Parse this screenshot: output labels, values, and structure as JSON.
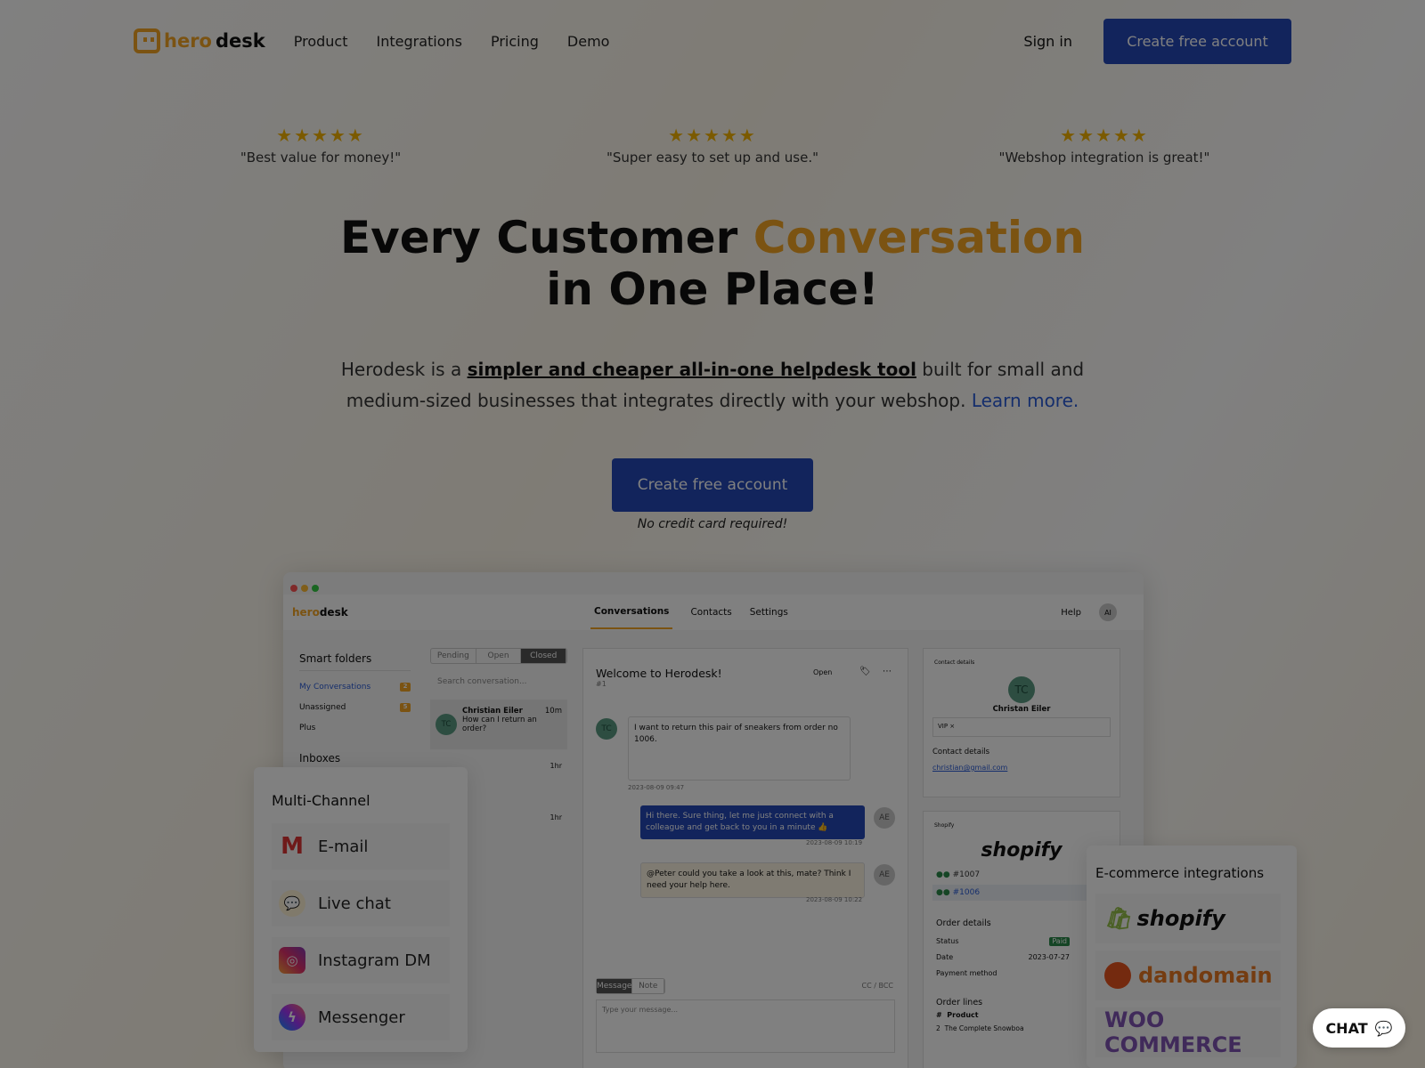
{
  "nav": {
    "logo_a": "hero",
    "logo_b": "desk",
    "links": [
      "Product",
      "Integrations",
      "Pricing",
      "Demo"
    ],
    "sign_in": "Sign in",
    "cta": "Create free account"
  },
  "reviews": [
    {
      "stars": "★★★★★",
      "text": "\"Best value for money!\""
    },
    {
      "stars": "★★★★★",
      "text": "\"Super easy to set up and use.\""
    },
    {
      "stars": "★★★★★",
      "text": "\"Webshop integration is great!\""
    }
  ],
  "hero": {
    "title_a": "Every Customer ",
    "title_accent": "Conversation",
    "title_b": " in One Place!",
    "sub_a": "Herodesk is a ",
    "sub_link": "simpler and cheaper all-in-one helpdesk tool",
    "sub_b": " built for small and medium-sized businesses that integrates directly with your webshop. ",
    "learn_more": "Learn more.",
    "cta": "Create free account",
    "note": "No credit card required!"
  },
  "app": {
    "logo_a": "hero",
    "logo_b": "desk",
    "tabs": [
      "Conversations",
      "Contacts",
      "Settings"
    ],
    "help": "Help",
    "avatar": "AI",
    "smart_folders": "Smart folders",
    "folders": [
      {
        "label": "My Conversations",
        "count": "2"
      },
      {
        "label": "Unassigned",
        "count": "5"
      },
      {
        "label": "Plus",
        "count": ""
      }
    ],
    "inboxes": "Inboxes",
    "filters": [
      "Pending",
      "Open",
      "Closed"
    ],
    "search_placeholder": "Search conversation...",
    "conv": {
      "initials": "TC",
      "name": "Christian Eiler",
      "time": "10m",
      "preview": "How can I return an order?"
    },
    "other_times": [
      "1hr",
      "1hr"
    ],
    "chat": {
      "title": "Welcome to Herodesk!",
      "id": "#1",
      "status": "Open",
      "m1": "I want to return this pair of sneakers from order no 1006.",
      "t1": "2023-08-09 09:47",
      "m2": "Hi there. Sure thing, let me just connect with a colleague and get back to you in a minute 👍",
      "t2": "2023-08-09 10:19",
      "m3": "@Peter could you take a look at this, mate? Think I need your help here.",
      "t3": "2023-08-09 10:22",
      "agent": "AE",
      "cust": "TC",
      "compose_tabs": [
        "Message",
        "Note"
      ],
      "ccbcc": "CC / BCC",
      "placeholder": "Type your message..."
    },
    "contact": {
      "header": "Contact details",
      "initials": "TC",
      "name": "Christan Eiler",
      "tag": "VIP",
      "section": "Contact details",
      "email": "christian@gmail.com"
    },
    "shop": {
      "header": "Shopify",
      "logo": "shopify",
      "orders": [
        "#1007",
        "#1006"
      ],
      "order_details": "Order details",
      "rows": [
        [
          "Status",
          "Paid"
        ],
        [
          "Date",
          "2023-07-27"
        ],
        [
          "Payment method",
          ""
        ]
      ],
      "order_lines": "Order lines",
      "cols": [
        "#",
        "Product"
      ],
      "line": [
        "2",
        "The Complete Snowboa"
      ]
    }
  },
  "multichannel": {
    "title": "Multi-Channel",
    "items": [
      "E-mail",
      "Live chat",
      "Instagram DM",
      "Messenger"
    ]
  },
  "ecommerce": {
    "title": "E-commerce integrations",
    "items": [
      "shopify",
      "dandomain",
      "WOO COMMERCE"
    ]
  },
  "chat_widget": "CHAT"
}
